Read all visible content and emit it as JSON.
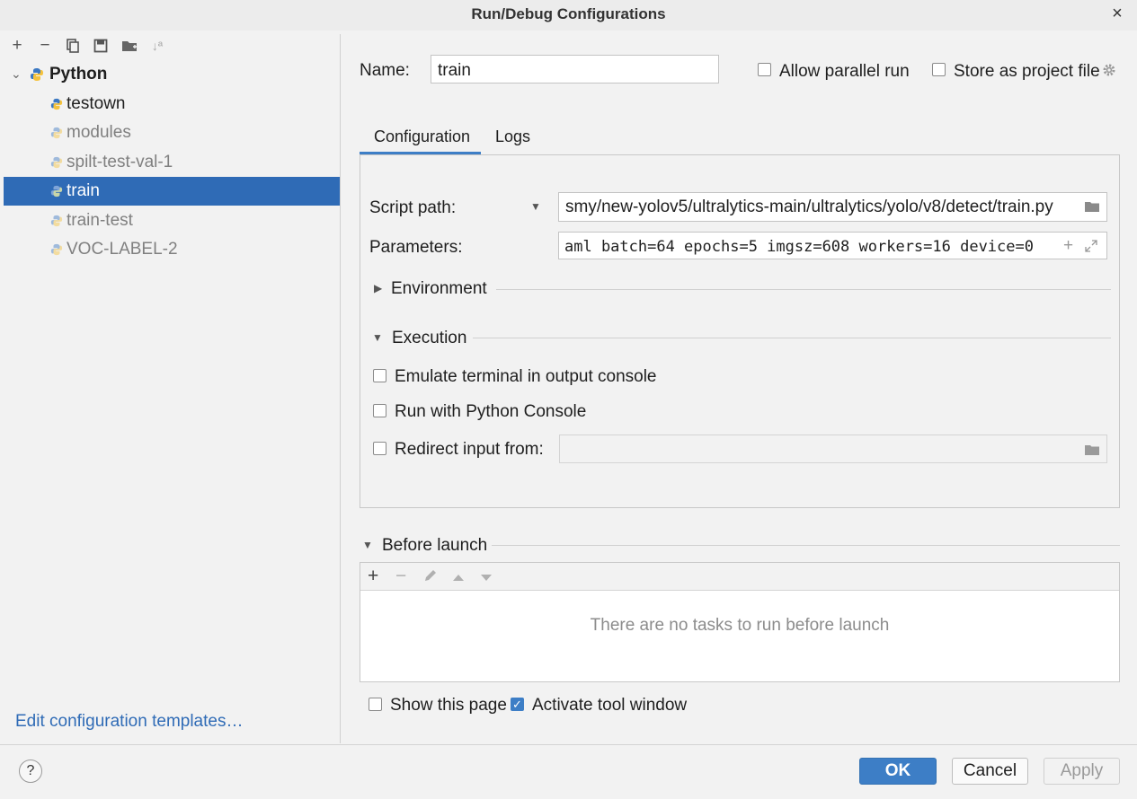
{
  "window": {
    "title": "Run/Debug Configurations",
    "close_glyph": "×"
  },
  "toolbar": {
    "icons": [
      "add-icon",
      "remove-icon",
      "copy-icon",
      "save-icon",
      "new-folder-icon",
      "sort-icon"
    ],
    "add": "+",
    "remove": "−",
    "sort": "↓ª"
  },
  "tree": {
    "root": {
      "label": "Python",
      "expand_glyph": "⌄"
    },
    "items": [
      {
        "label": "testown"
      },
      {
        "label": "modules"
      },
      {
        "label": "spilt-test-val-1"
      },
      {
        "label": "train"
      },
      {
        "label": "train-test"
      },
      {
        "label": "VOC-LABEL-2"
      }
    ]
  },
  "edit_templates_link": "Edit configuration templates…",
  "help_glyph": "?",
  "form": {
    "name_label": "Name:",
    "name_value": "train",
    "allow_parallel_label": "Allow parallel run",
    "store_project_label": "Store as project file"
  },
  "tabs": [
    {
      "label": "Configuration"
    },
    {
      "label": "Logs"
    }
  ],
  "config": {
    "script_path_label": "Script path:",
    "script_path_value": "smy/new-yolov5/ultralytics-main/ultralytics/yolo/v8/detect/train.py",
    "parameters_label": "Parameters:",
    "parameters_value": "aml batch=64 epochs=5 imgsz=608 workers=16 device=0",
    "environment_label": "Environment",
    "execution_label": "Execution",
    "emulate_label": "Emulate terminal in output console",
    "python_console_label": "Run with Python Console",
    "redirect_label": "Redirect input from:",
    "redirect_value": ""
  },
  "before_launch": {
    "label": "Before launch",
    "empty_text": "There are no tasks to run before launch",
    "toolbar": {
      "add": "+",
      "remove": "−"
    }
  },
  "options": {
    "show_page_label": "Show this page",
    "show_page_checked": false,
    "activate_tool_label": "Activate tool window",
    "activate_tool_checked": true
  },
  "buttons": {
    "ok": "OK",
    "cancel": "Cancel",
    "apply": "Apply"
  },
  "colors": {
    "accent": "#3d7ec6",
    "selection": "#2f6bb6",
    "link": "#2f6bb6"
  }
}
